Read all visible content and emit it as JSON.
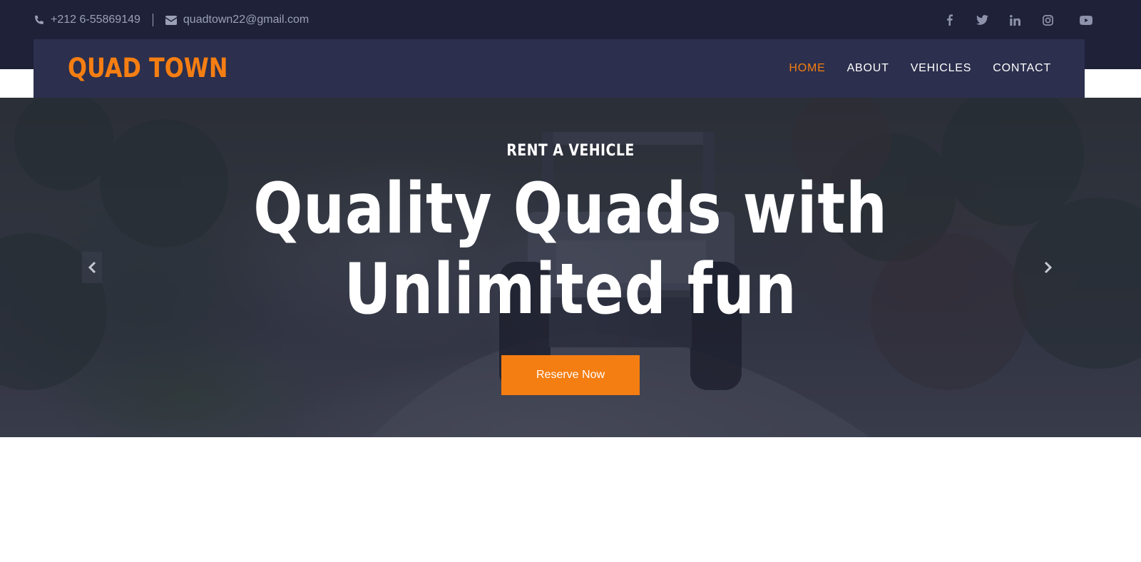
{
  "topbar": {
    "phone": "+212 6-55869149",
    "email": "quadtown22@gmail.com",
    "phone_icon": "phone-icon",
    "email_icon": "envelope-icon",
    "social": [
      "facebook-icon",
      "twitter-icon",
      "linkedin-icon",
      "instagram-icon",
      "youtube-icon"
    ]
  },
  "navbar": {
    "brand": "QUAD TOWN",
    "links": [
      {
        "label": "HOME",
        "active": true
      },
      {
        "label": "ABOUT",
        "active": false
      },
      {
        "label": "VEHICLES",
        "active": false
      },
      {
        "label": "CONTACT",
        "active": false
      }
    ]
  },
  "hero": {
    "kicker": "RENT A VEHICLE",
    "title_line1": "Quality Quads with",
    "title_line2": "Unlimited fun",
    "button": "Reserve Now",
    "prev_icon": "chevron-left-icon",
    "next_icon": "chevron-right-icon"
  },
  "colors": {
    "topbar_bg": "#1e2137",
    "navbar_bg": "#2c2f4d",
    "accent": "#f57e12",
    "muted_text": "#9ca0b7"
  }
}
